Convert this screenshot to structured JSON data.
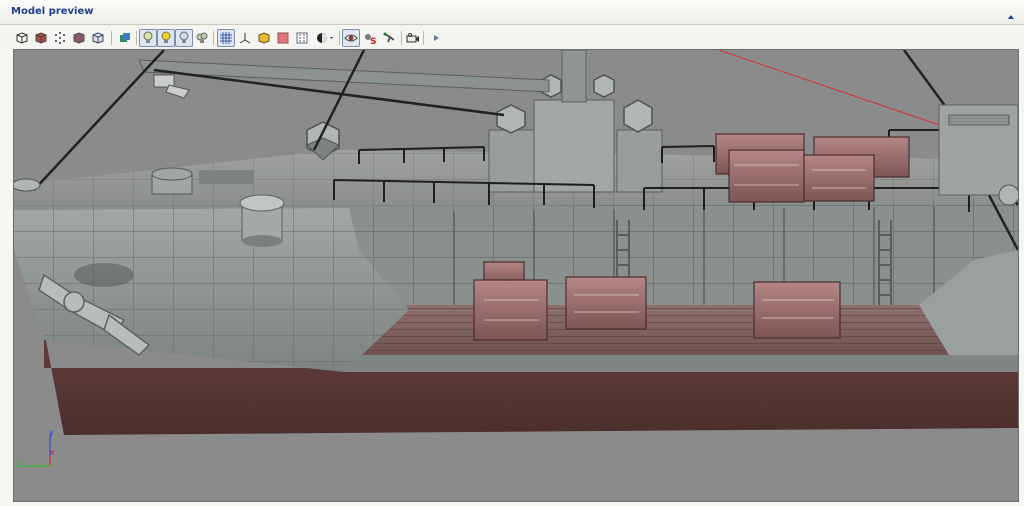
{
  "panel": {
    "title": "Model preview"
  },
  "toolbar": {
    "buttons": [
      {
        "name": "view-front-icon"
      },
      {
        "name": "view-side-icon"
      },
      {
        "name": "points-icon"
      },
      {
        "name": "solid-cube-icon"
      },
      {
        "name": "wire-cube-icon"
      },
      {
        "name": "shader-icon"
      },
      {
        "name": "light-1-icon",
        "active": true
      },
      {
        "name": "light-2-icon",
        "active": true
      },
      {
        "name": "light-3-icon",
        "active": true
      },
      {
        "name": "light-4-icon"
      },
      {
        "name": "grid-icon",
        "active": true
      },
      {
        "name": "axes-icon"
      },
      {
        "name": "bounding-box-icon"
      },
      {
        "name": "texture-icon"
      },
      {
        "name": "normals-icon"
      },
      {
        "name": "shading-dropdown-icon"
      },
      {
        "name": "eye-icon",
        "active": true
      },
      {
        "name": "animation-icon"
      },
      {
        "name": "skeleton-icon"
      },
      {
        "name": "camera-icon"
      },
      {
        "name": "play-icon"
      }
    ]
  },
  "viewport": {
    "background": "#8b8b8b",
    "axis_labels": {
      "x": "x",
      "y": "y",
      "z": "z"
    },
    "axis_colors": {
      "x": "#e02020",
      "y": "#2040e0",
      "z": "#20c020"
    }
  },
  "colors": {
    "title": "#1e3f8f",
    "hull_steel": "#8f9693",
    "hull_red": "#5a3634",
    "crate": "#9b6f6f"
  }
}
